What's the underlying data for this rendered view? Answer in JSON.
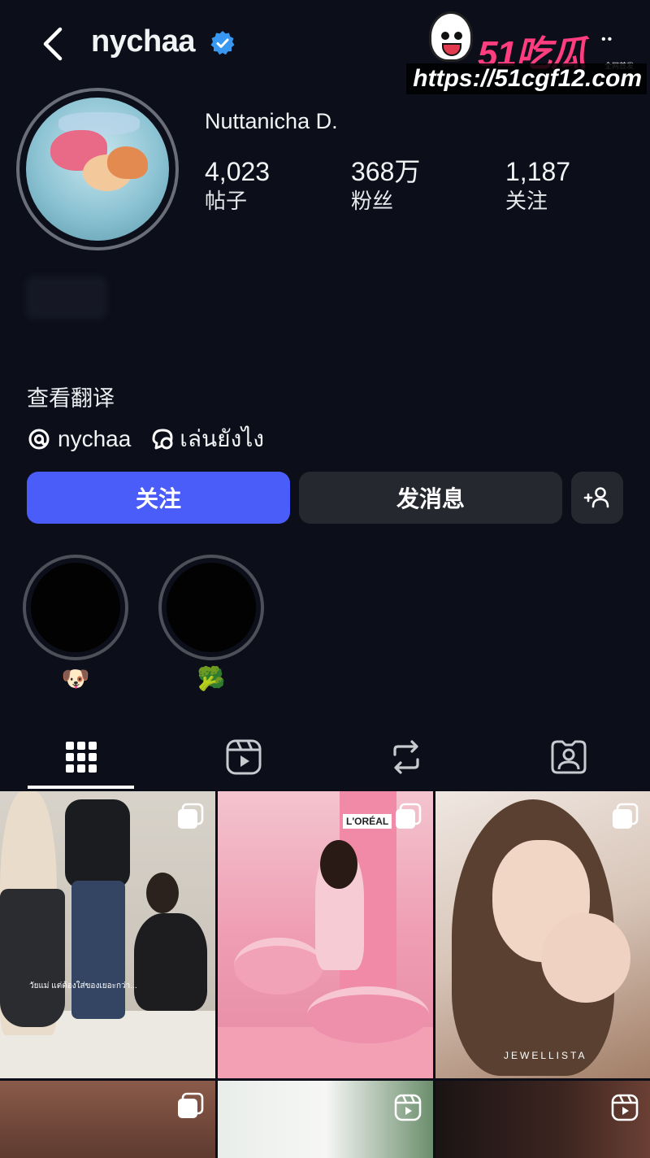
{
  "header": {
    "username": "nychaa"
  },
  "watermark": {
    "logo": "51吃瓜",
    "tagline": "全网首发",
    "url": "https://51cgf12.com"
  },
  "profile": {
    "display_name": "Nuttanicha D.",
    "stats": [
      {
        "value": "4,023",
        "label": "帖子"
      },
      {
        "value": "368万",
        "label": "粉丝"
      },
      {
        "value": "1,187",
        "label": "关注"
      }
    ],
    "translate_label": "查看翻译",
    "threads_handle": "nychaa",
    "link_text": "เล่นยังไง"
  },
  "actions": {
    "follow_label": "关注",
    "message_label": "发消息"
  },
  "highlights": [
    {
      "label": "🐶"
    },
    {
      "label": "🥦"
    }
  ],
  "tabs": [
    {
      "name": "grid-icon"
    },
    {
      "name": "reels-icon"
    },
    {
      "name": "reposts-icon"
    },
    {
      "name": "tagged-icon"
    }
  ],
  "posts": {
    "jewellery_brand": "JEWELLISTA",
    "loreal_sign": "L'ORÉAL",
    "caption_overlay": "วัยแม่ แต่ต้องใส่ของเยอะกว่า..."
  },
  "colors": {
    "background": "#0c0f1a",
    "follow_button": "#4a5df9",
    "secondary_button": "#25282f",
    "verified_badge": "#3897f0",
    "watermark_pink": "#ff3d7f"
  }
}
